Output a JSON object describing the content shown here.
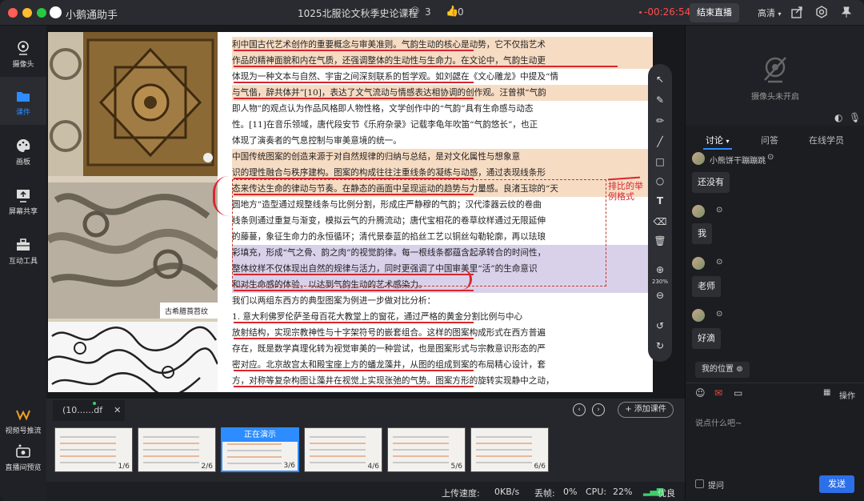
{
  "app": {
    "name": "小鹅通助手",
    "course": "1025北服论文秋季史论课程",
    "viewers": "3",
    "likes": "0",
    "timer": "-00:26:54",
    "end_button": "结束直播",
    "quality": "高清"
  },
  "sidebar": {
    "items": [
      {
        "label": "摄像头"
      },
      {
        "label": "课件"
      },
      {
        "label": "画板"
      },
      {
        "label": "屏幕共享"
      },
      {
        "label": "互动工具"
      },
      {
        "label": "视频号推流"
      },
      {
        "label": "直播间预览"
      }
    ]
  },
  "slide": {
    "image_caption": "古希腊莨苕纹",
    "annotation": "排比的举例格式",
    "lines": [
      "利中国古代艺术创作的重要概念与审美准则。气韵生动的核心是动势，它不仅指艺术",
      "作品的精神面貌和内在气质，还强调整体的生动性与生命力。在文论中，气韵生动更",
      "体现为一种文本与自然、宇宙之间深刻联系的哲学观。如刘勰在《文心雕龙》中提及“情",
      "与气偕，辞共体并”[10]，表达了文气流动与情感表达相协调的创作观。汪曾祺“气韵",
      "即人物”的观点认为作品风格即人物性格，文学创作中的“气韵”具有生命感与动态",
      "性。[11]在音乐领域，唐代段安节《乐府杂录》记载李龟年吹笛“气韵悠长”，也正",
      "体现了演奏者的气息控制与审美意境的统一。",
      "    中国传统图案的创造来源于对自然规律的归纳与总结，是对文化属性与想象意",
      "识的理性融合与秩序建构。图案的构成往往注重线条的凝练与动感，通过表现线条形",
      "态来传达生命的律动与节奏。在静态的画面中呈现运动的趋势与力量感。良渚玉琮的“天",
      "圆地方”造型通过规整线条与比例分割，形成庄严静穆的气韵；汉代漆器云纹的卷曲",
      "线条则通过重复与渐变，模拟云气的升腾流动；唐代宝相花的卷草纹样通过无限延伸",
      "的藤蔓，象征生命力的永恒循环；清代景泰蓝的掐丝工艺以铜丝勾勒轮廓，再以珐琅",
      "彩填充，形成“气之骨、韵之肉”的视觉韵律。每一根线条都蕴含起承转合的时间性，",
      "整体纹样不仅体现出自然的规律与活力，同时更强调了中国审美里“活”的生命意识",
      "和对生命感的体验，以达到气韵生动的艺术感染力。",
      "    我们以两组东西方的典型图案为例进一步做对比分析：",
      "    1. 意大利佛罗伦萨圣母百花大教堂上的窗花，通过严格的黄金分割比例与中心",
      "放射结构，实现宗教神性与十字架符号的嵌套组合。这样的图案构成形式在西方普遍",
      "存在，既是数学真理化转为视觉审美的一种尝试，也是图案形式与宗教意识形态的严",
      "密对应。北京故宫太和殿宝座上方的蟠龙藻井，从图的组成到案的布局精心设计，套",
      "方，对称等复杂构图让藻井在视觉上实现张弛的气势。图案方形的旋转实现静中之动，"
    ]
  },
  "drawtool": {
    "zoom": "230%"
  },
  "thumbs": {
    "file": "(10......df",
    "add_button": "添加课件",
    "presenting": "正在演示",
    "pages": [
      "1/6",
      "2/6",
      "3/6",
      "4/6",
      "5/6",
      "6/6"
    ],
    "current_index": 2
  },
  "status": {
    "upload_label": "上传速度:",
    "upload": "0KB/s",
    "loss_label": "丢帧:",
    "loss": "0%",
    "cpu_label": "CPU:",
    "cpu": "22%",
    "quality": "优良"
  },
  "right": {
    "camera_off": "摄像头未开启",
    "tabs": [
      "讨论",
      "问答",
      "在线学员"
    ],
    "messages": [
      {
        "user": "小熊饼干蹦蹦跳",
        "text": "还没有"
      },
      {
        "user": "",
        "text": "我"
      },
      {
        "user": "",
        "text": "老师"
      },
      {
        "user": "",
        "text": "好滴"
      }
    ],
    "my_position": "我的位置",
    "ops": "操作",
    "placeholder": "说点什么吧~",
    "ask": "提问",
    "send": "发送"
  }
}
